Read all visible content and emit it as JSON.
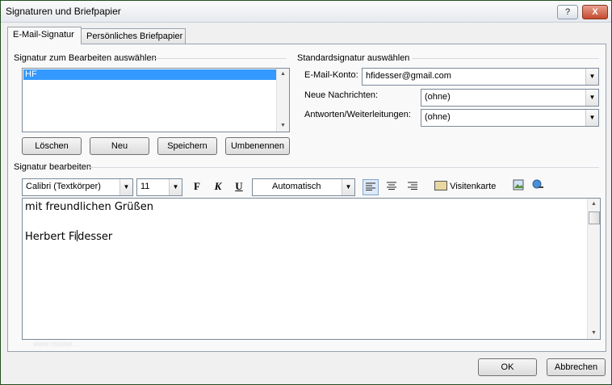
{
  "window": {
    "title": "Signaturen und Briefpapier"
  },
  "titlebar_buttons": {
    "help": "?",
    "minimize": "–",
    "close": "X"
  },
  "tabs": [
    {
      "label": "E-Mail-Signatur"
    },
    {
      "label": "Persönliches Briefpapier"
    }
  ],
  "signature_select": {
    "heading": "Signatur zum Bearbeiten auswählen",
    "items": [
      "HF"
    ],
    "buttons": {
      "delete": "Löschen",
      "new": "Neu",
      "save": "Speichern",
      "rename": "Umbenennen"
    }
  },
  "default_signature": {
    "heading": "Standardsignatur auswählen",
    "account_label": "E-Mail-Konto:",
    "account_value": "hfidesser@gmail.com",
    "new_messages_label": "Neue Nachrichten:",
    "new_messages_value": "(ohne)",
    "replies_label": "Antworten/Weiterleitungen:",
    "replies_value": "(ohne)"
  },
  "editor": {
    "heading": "Signatur bearbeiten",
    "font_value": "Calibri (Textkörper)",
    "size_value": "11",
    "bold": "F",
    "italic": "K",
    "underline": "U",
    "color_value": "Automatisch",
    "business_card_label": "Visitenkarte",
    "line1": "mit freundlichen Grüßen",
    "line2_before_caret": "Herbert Fi",
    "line2_after_caret": "desser"
  },
  "footer": {
    "ok": "OK",
    "cancel": "Abbrechen"
  },
  "watermark": "www.muster..."
}
